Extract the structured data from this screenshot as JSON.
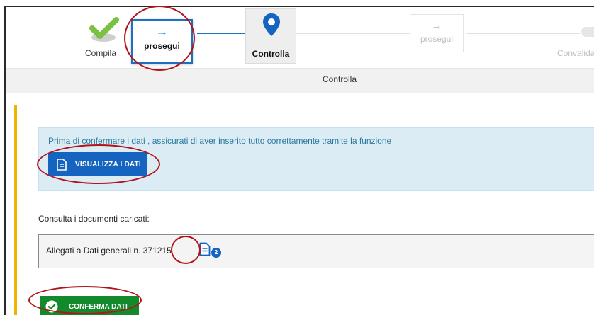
{
  "stepper": {
    "steps": [
      {
        "label": "Compila",
        "status": "done"
      },
      {
        "label": "Controlla",
        "status": "current"
      },
      {
        "label": "Convalida",
        "status": "future"
      }
    ],
    "next_button_label": "prosegui",
    "next_button_disabled_label": "prosegui"
  },
  "breadcrumb": {
    "title": "Controlla"
  },
  "info": {
    "message": "Prima di confermare i dati , assicurati di aver inserito tutto correttamente tramite la funzione",
    "view_button_label": "VISUALIZZA I DATI"
  },
  "documents": {
    "title": "Consulta i documenti caricati:",
    "attachment_label": "Allegati a Dati generali n. 371215",
    "attachment_count": "2"
  },
  "confirm_button_label": "CONFERMA DATI",
  "colors": {
    "primary": "#1565c0",
    "success": "#128a2b",
    "accent": "#f0b400",
    "annotation": "#b3121a"
  }
}
